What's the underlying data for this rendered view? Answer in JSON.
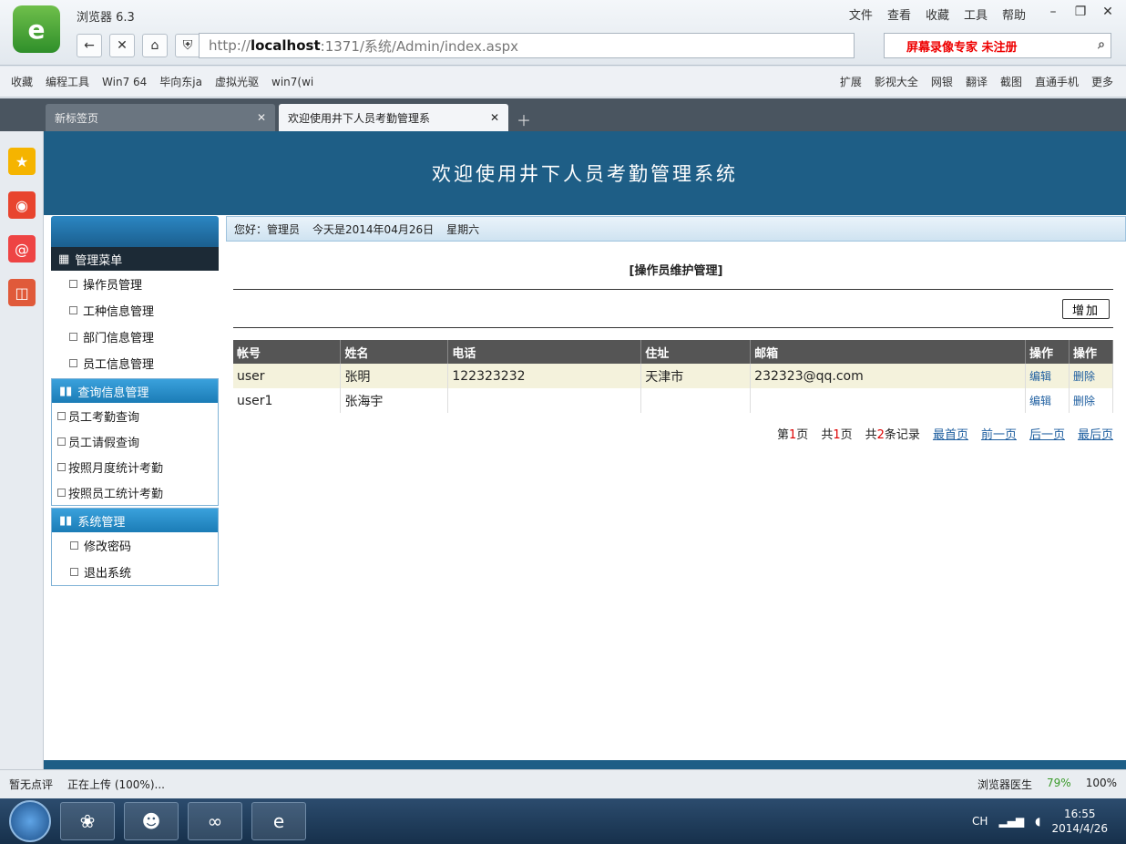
{
  "browser": {
    "app_title": "浏览器 6.3",
    "menu": [
      "文件",
      "查看",
      "收藏",
      "工具",
      "帮助"
    ],
    "address_host": "localhost",
    "address_rest": ":1371/系统/Admin/index.aspx",
    "address_prefix": "http://",
    "search_text": "屏幕录像专家 未注册",
    "bookmarks": [
      "收藏",
      "编程工具",
      "Win7 64",
      "毕向东ja",
      "虚拟光驱",
      "win7(wi"
    ],
    "bookmarks_right": [
      "扩展",
      "影视大全",
      "网银",
      "翻译",
      "截图",
      "直通手机",
      "更多"
    ],
    "tabs": [
      "新标签页",
      "欢迎使用井下人员考勤管理系"
    ]
  },
  "page": {
    "banner": "欢迎使用井下人员考勤管理系统",
    "greeting": "您好：管理员",
    "date_text": "今天是2014年04月26日",
    "weekday": "星期六",
    "panel_title": "[操作员维护管理]",
    "add_label": "增加"
  },
  "sidebar": {
    "title": "管理菜单",
    "items": [
      "操作员管理",
      "工种信息管理",
      "部门信息管理",
      "员工信息管理"
    ],
    "group_query": {
      "title": "查询信息管理",
      "items": [
        "员工考勤查询",
        "员工请假查询",
        "按照月度统计考勤",
        "按照员工统计考勤"
      ]
    },
    "group_system": {
      "title": "系统管理",
      "items": [
        "修改密码",
        "退出系统"
      ]
    }
  },
  "table": {
    "columns": [
      "帐号",
      "姓名",
      "电话",
      "住址",
      "邮箱",
      "操作",
      "操作"
    ],
    "rows": [
      {
        "account": "user",
        "name": "张明",
        "phone": "122323232",
        "address": "天津市",
        "email": "232323@qq.com",
        "edit": "编辑",
        "delete": "删除"
      },
      {
        "account": "user1",
        "name": "张海宇",
        "phone": "",
        "address": "",
        "email": "",
        "edit": "编辑",
        "delete": "删除"
      }
    ]
  },
  "pager": {
    "page_prefix": "第",
    "page_num": "1",
    "page_suffix": "页",
    "total_prefix": "共",
    "total_num": "1",
    "total_suffix": "页",
    "records_prefix": "共",
    "records_num": "2",
    "records_suffix": "条记录",
    "first": "最首页",
    "prev": "前一页",
    "next": "后一页",
    "last": "最后页"
  },
  "status": {
    "comment": "暂无点评",
    "upload": "正在上传 (100%)...",
    "doctor": "浏览器医生",
    "percent": "79%",
    "zoom": "100%"
  },
  "taskbar": {
    "time": "16:55",
    "date": "2014/4/26",
    "lang": "CH"
  },
  "colors": {
    "banner": "#1e5e86",
    "link": "#1f5fa0",
    "row_highlight": "#f4f2dc"
  }
}
